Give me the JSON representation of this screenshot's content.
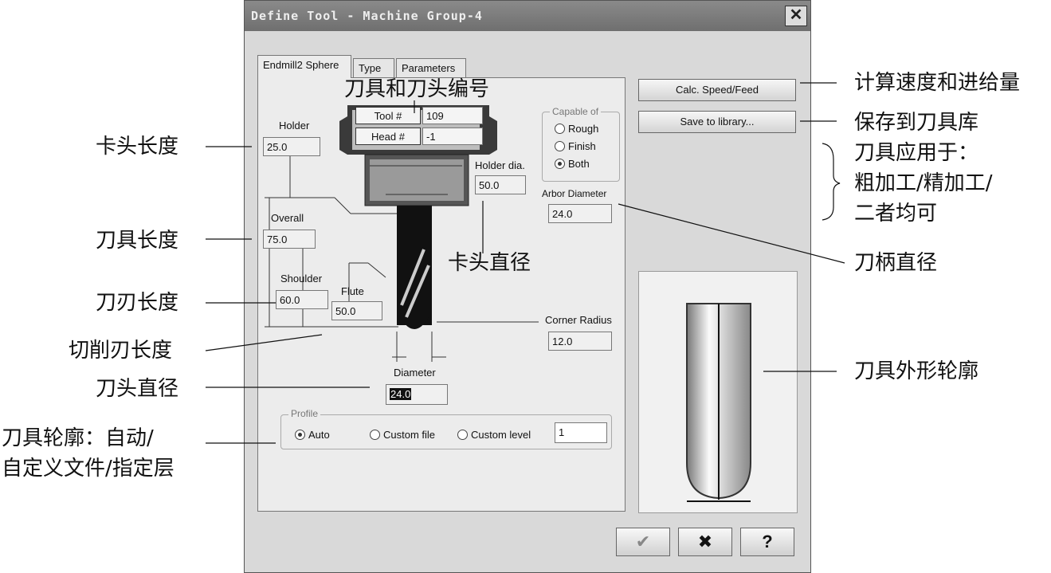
{
  "window": {
    "title": "Define Tool - Machine Group-4",
    "close_label": "✕"
  },
  "tabs": [
    {
      "label": "Endmill2 Sphere",
      "active": true
    },
    {
      "label": "Type",
      "active": false
    },
    {
      "label": "Parameters",
      "active": false
    }
  ],
  "tool": {
    "tool_num_label": "Tool #",
    "tool_num_value": "109",
    "head_num_label": "Head #",
    "head_num_value": "-1"
  },
  "fields": {
    "holder": {
      "label": "Holder",
      "value": "25.0"
    },
    "holder_dia": {
      "label": "Holder dia.",
      "value": "50.0"
    },
    "arbor_dia": {
      "label": "Arbor Diameter",
      "value": "24.0"
    },
    "overall": {
      "label": "Overall",
      "value": "75.0"
    },
    "shoulder": {
      "label": "Shoulder",
      "value": "60.0"
    },
    "flute": {
      "label": "Flute",
      "value": "50.0"
    },
    "corner_radius": {
      "label": "Corner Radius",
      "value": "12.0"
    },
    "diameter": {
      "label": "Diameter",
      "value": "24.0"
    }
  },
  "capable_of": {
    "title": "Capable of",
    "options": [
      "Rough",
      "Finish",
      "Both"
    ],
    "selected": "Both"
  },
  "profile": {
    "title": "Profile",
    "options": [
      "Auto",
      "Custom file",
      "Custom level"
    ],
    "selected": "Auto",
    "level_value": "1"
  },
  "buttons": {
    "calc_speed_feed": "Calc. Speed/Feed",
    "save_to_library": "Save to library...",
    "ok_icon": "✔",
    "cancel_icon": "✖",
    "help_icon": "?"
  },
  "annotations": {
    "tool_head_number": "刀具和刀头编号",
    "holder_length": "卡头长度",
    "tool_length": "刀具长度",
    "flute_length": "刀刃长度",
    "cutting_length": "切削刃长度",
    "head_diameter": "刀头直径",
    "tool_profile_line1": "刀具轮廓：自动/",
    "tool_profile_line2": "自定义文件/指定层",
    "holder_diameter": "卡头直径",
    "calc_speed": "计算速度和进给量",
    "save_library": "保存到刀具库",
    "applies_line1": "刀具应用于：",
    "applies_line2": "粗加工/精加工/",
    "applies_line3": "二者均可",
    "arbor_diameter": "刀柄直径",
    "tool_outline": "刀具外形轮廓"
  }
}
